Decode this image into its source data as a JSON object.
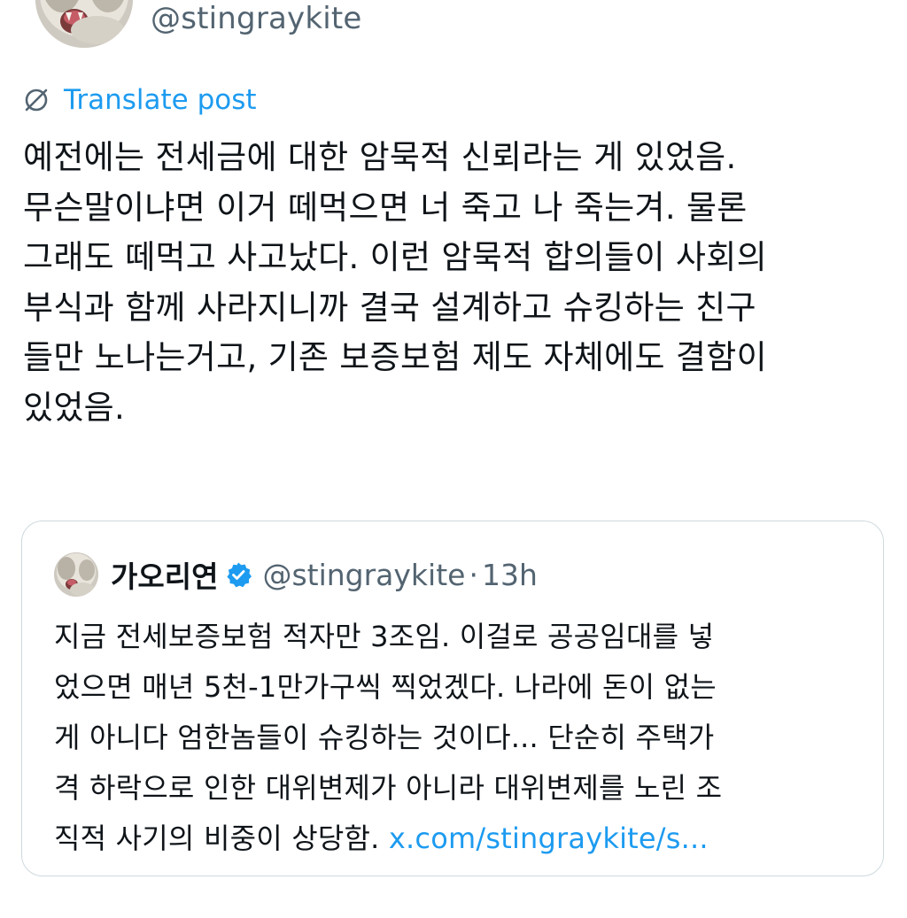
{
  "post": {
    "handle": "@stingraykite",
    "translate_label": "Translate post",
    "text_lines": [
      "예전에는 전세금에 대한 암묵적 신뢰라는 게 있었음.",
      "무슨말이냐면 이거 떼먹으면 너 죽고 나 죽는겨. 물론",
      "그래도 떼먹고 사고났다. 이런 암묵적 합의들이 사회의",
      "부식과 함께 사라지니까 결국 설계하고 슈킹하는 친구",
      "들만 노나는거고, 기존 보증보험 제도 자체에도 결함이",
      "있었음."
    ]
  },
  "quote": {
    "name": "가오리연",
    "handle": "@stingraykite",
    "separator": "·",
    "time": "13h",
    "text_lines": [
      "지금 전세보증보험 적자만 3조임. 이걸로 공공임대를 넣",
      "었으면 매년 5천-1만가구씩 찍었겠다. 나라에 돈이 없는",
      "게 아니다 엄한놈들이 슈킹하는 것이다... 단순히 주택가",
      "격 하락으로 인한 대위변제가 아니라 대위변제를 노린 조"
    ],
    "last_line_text": "직적 사기의 비중이 상당함.",
    "link_text": "x.com/stingraykite/s..."
  },
  "icons": {
    "translate": "globe-slash-icon",
    "verified": "verified-badge-icon",
    "avatar": "cat-avatar"
  },
  "colors": {
    "link": "#1d9bf0",
    "secondary_text": "#536471",
    "primary_text": "#0f1419",
    "border": "#cfd9de"
  }
}
